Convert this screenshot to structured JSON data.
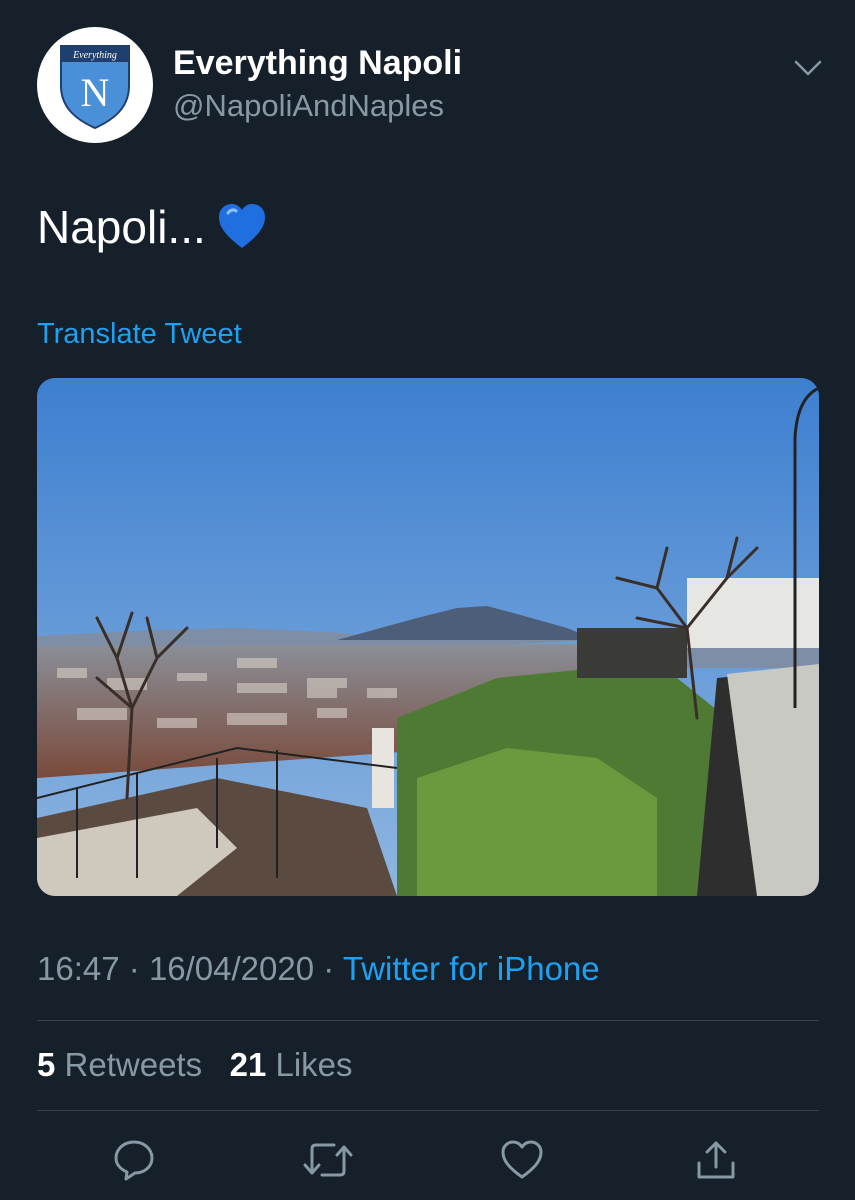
{
  "tweet": {
    "display_name": "Everything Napoli",
    "handle": "@NapoliAndNaples",
    "avatar_text": "Everything",
    "avatar_letter": "N",
    "text": "Napoli...",
    "emoji": "blue-heart",
    "translate_label": "Translate Tweet",
    "time": "16:47",
    "date": "16/04/2020",
    "separator": "·",
    "source": "Twitter for iPhone",
    "retweets_count": "5",
    "retweets_label": "Retweets",
    "likes_count": "21",
    "likes_label": "Likes"
  },
  "icons": {
    "more": "chevron-down-icon",
    "reply": "reply-icon",
    "retweet": "retweet-icon",
    "like": "like-icon",
    "share": "share-icon"
  },
  "colors": {
    "background": "#15202b",
    "accent": "#1da1f2",
    "secondary_text": "#8899a6",
    "divider": "#38444d"
  }
}
